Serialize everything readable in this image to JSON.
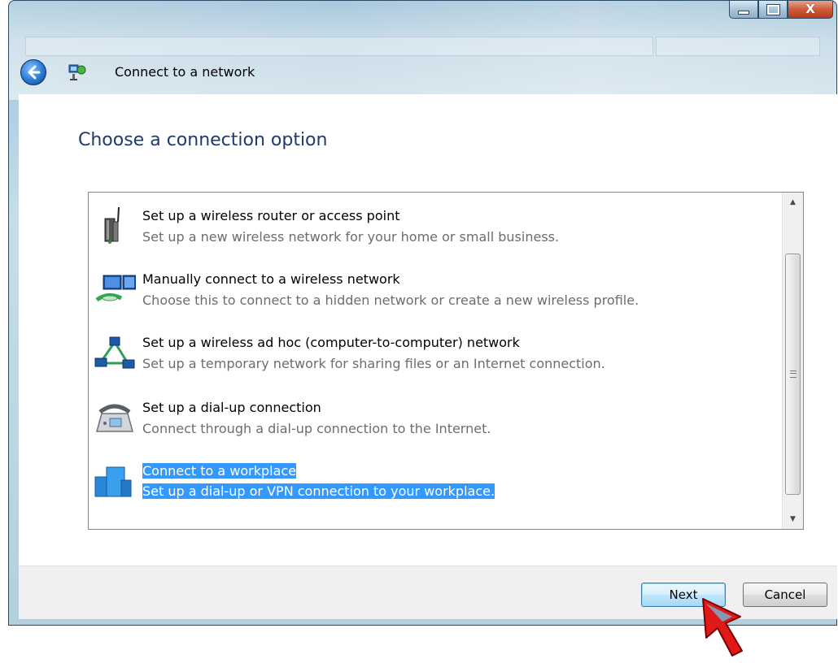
{
  "window": {
    "title": "Connect to a network",
    "accent": "#1e3a6e",
    "selection_color": "#3399ff"
  },
  "caption": {
    "minimize_icon": "minimize-icon",
    "maximize_icon": "maximize-icon",
    "close_glyph": "X"
  },
  "page": {
    "heading": "Choose a connection option"
  },
  "options": [
    {
      "icon": "wireless-router-icon",
      "title": "Set up a wireless router or access point",
      "description": "Set up a new wireless network for your home or small business."
    },
    {
      "icon": "wireless-network-icon",
      "title": "Manually connect to a wireless network",
      "description": "Choose this to connect to a hidden network or create a new wireless profile."
    },
    {
      "icon": "ad-hoc-network-icon",
      "title": "Set up a wireless ad hoc (computer-to-computer) network",
      "description": "Set up a temporary network for sharing files or an Internet connection."
    },
    {
      "icon": "dial-up-phone-icon",
      "title": "Set up a dial-up connection",
      "description": "Connect through a dial-up connection to the Internet."
    },
    {
      "icon": "workplace-icon",
      "title": "Connect to a workplace",
      "description": "Set up a dial-up or VPN connection to your workplace.",
      "selected": true
    }
  ],
  "footer": {
    "next_label": "Next",
    "cancel_label": "Cancel"
  }
}
